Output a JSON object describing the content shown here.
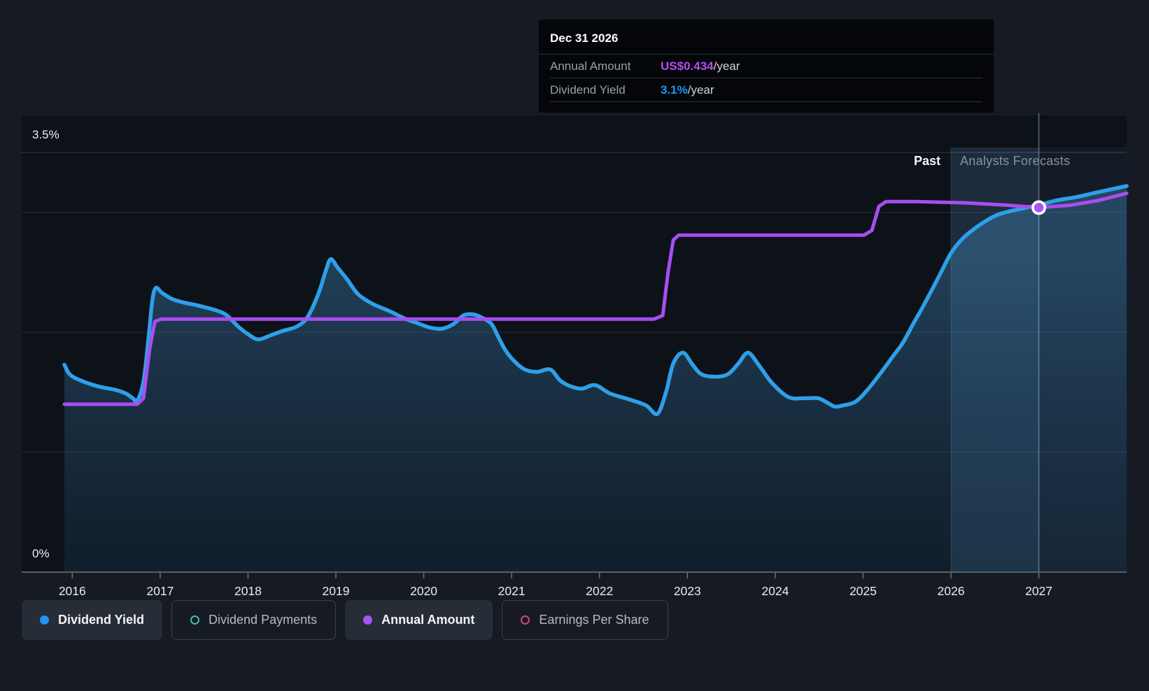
{
  "tooltip": {
    "title": "Dec 31 2026",
    "rows": [
      {
        "label": "Annual Amount",
        "value": "US$0.434",
        "suffix": "/year",
        "value_color": "#b44bf2"
      },
      {
        "label": "Dividend Yield",
        "value": "3.1%",
        "suffix": "/year",
        "value_color": "#2196f3"
      }
    ]
  },
  "axis": {
    "top_label": "3.5%",
    "bottom_label": "0%"
  },
  "regions": {
    "past_label": "Past",
    "forecast_label": "Analysts Forecasts"
  },
  "chart_data": {
    "type": "area",
    "title": "Dividend history and forecast",
    "x_ticks": [
      "2016",
      "2017",
      "2018",
      "2019",
      "2020",
      "2021",
      "2022",
      "2023",
      "2024",
      "2025",
      "2026",
      "2027"
    ],
    "x_tick_years": [
      2016,
      2017,
      2018,
      2019,
      2020,
      2021,
      2022,
      2023,
      2024,
      2025,
      2026,
      2027
    ],
    "x_range": [
      2015.91,
      2028.0
    ],
    "y_axis": {
      "min_pct": 0,
      "max_pct": 3.5,
      "gridlines_pct": [
        3.5,
        3.0,
        2.0,
        1.0
      ]
    },
    "forecast_divider_year": 2026.0,
    "hover_band_years": [
      2026.0,
      2027.0
    ],
    "selected_point": {
      "date": "Dec 31 2026",
      "year": 2027.0,
      "annual_amount_displayed": "US$0.434/year",
      "dividend_yield_displayed": "3.1%/year",
      "plotted_pct": 3.04
    },
    "series": [
      {
        "name": "Dividend Yield",
        "color": "#2e9fe8",
        "area": true,
        "smooth": true,
        "points": [
          [
            2015.91,
            1.73
          ],
          [
            2015.97,
            1.65
          ],
          [
            2016.09,
            1.6
          ],
          [
            2016.29,
            1.55
          ],
          [
            2016.49,
            1.52
          ],
          [
            2016.61,
            1.49
          ],
          [
            2016.69,
            1.45
          ],
          [
            2016.74,
            1.43
          ],
          [
            2016.81,
            1.59
          ],
          [
            2016.87,
            1.97
          ],
          [
            2016.91,
            2.26
          ],
          [
            2016.95,
            2.37
          ],
          [
            2017.02,
            2.33
          ],
          [
            2017.13,
            2.28
          ],
          [
            2017.26,
            2.25
          ],
          [
            2017.45,
            2.22
          ],
          [
            2017.65,
            2.18
          ],
          [
            2017.76,
            2.14
          ],
          [
            2017.9,
            2.04
          ],
          [
            2018.03,
            1.97
          ],
          [
            2018.12,
            1.94
          ],
          [
            2018.24,
            1.97
          ],
          [
            2018.39,
            2.01
          ],
          [
            2018.56,
            2.05
          ],
          [
            2018.68,
            2.13
          ],
          [
            2018.8,
            2.32
          ],
          [
            2018.88,
            2.5
          ],
          [
            2018.94,
            2.61
          ],
          [
            2019.02,
            2.54
          ],
          [
            2019.13,
            2.44
          ],
          [
            2019.25,
            2.32
          ],
          [
            2019.41,
            2.24
          ],
          [
            2019.6,
            2.18
          ],
          [
            2019.8,
            2.11
          ],
          [
            2019.95,
            2.07
          ],
          [
            2020.07,
            2.04
          ],
          [
            2020.21,
            2.03
          ],
          [
            2020.34,
            2.07
          ],
          [
            2020.45,
            2.14
          ],
          [
            2020.56,
            2.15
          ],
          [
            2020.67,
            2.12
          ],
          [
            2020.77,
            2.07
          ],
          [
            2020.85,
            1.96
          ],
          [
            2020.93,
            1.85
          ],
          [
            2021.03,
            1.76
          ],
          [
            2021.15,
            1.69
          ],
          [
            2021.29,
            1.67
          ],
          [
            2021.44,
            1.69
          ],
          [
            2021.55,
            1.6
          ],
          [
            2021.67,
            1.55
          ],
          [
            2021.8,
            1.53
          ],
          [
            2021.95,
            1.56
          ],
          [
            2022.12,
            1.49
          ],
          [
            2022.34,
            1.44
          ],
          [
            2022.53,
            1.39
          ],
          [
            2022.66,
            1.32
          ],
          [
            2022.76,
            1.51
          ],
          [
            2022.84,
            1.74
          ],
          [
            2022.95,
            1.83
          ],
          [
            2023.06,
            1.73
          ],
          [
            2023.16,
            1.65
          ],
          [
            2023.31,
            1.63
          ],
          [
            2023.46,
            1.65
          ],
          [
            2023.58,
            1.74
          ],
          [
            2023.69,
            1.83
          ],
          [
            2023.81,
            1.73
          ],
          [
            2023.96,
            1.58
          ],
          [
            2024.15,
            1.46
          ],
          [
            2024.33,
            1.45
          ],
          [
            2024.49,
            1.45
          ],
          [
            2024.6,
            1.41
          ],
          [
            2024.68,
            1.38
          ],
          [
            2024.77,
            1.39
          ],
          [
            2024.91,
            1.42
          ],
          [
            2025.05,
            1.52
          ],
          [
            2025.21,
            1.67
          ],
          [
            2025.34,
            1.8
          ],
          [
            2025.45,
            1.91
          ],
          [
            2025.57,
            2.07
          ],
          [
            2025.67,
            2.2
          ],
          [
            2025.78,
            2.35
          ],
          [
            2025.88,
            2.49
          ],
          [
            2026.0,
            2.66
          ],
          [
            2026.13,
            2.78
          ],
          [
            2026.26,
            2.86
          ],
          [
            2026.4,
            2.93
          ],
          [
            2026.53,
            2.98
          ],
          [
            2026.67,
            3.01
          ],
          [
            2026.8,
            3.03
          ],
          [
            2026.92,
            3.05
          ],
          [
            2027.0,
            3.06
          ],
          [
            2027.2,
            3.1
          ],
          [
            2027.44,
            3.13
          ],
          [
            2027.68,
            3.17
          ],
          [
            2028.0,
            3.22
          ]
        ]
      },
      {
        "name": "Annual Amount",
        "color": "#a84df0",
        "area": false,
        "smooth": false,
        "note": "plotted against a hidden amount axis; values expressed as left-axis equivalents; labeled value US$0.434/year at Dec 31 2026",
        "points": [
          [
            2015.91,
            1.4
          ],
          [
            2016.74,
            1.4
          ],
          [
            2016.81,
            1.45
          ],
          [
            2016.88,
            1.86
          ],
          [
            2016.94,
            2.09
          ],
          [
            2017.01,
            2.11
          ],
          [
            2022.62,
            2.11
          ],
          [
            2022.72,
            2.14
          ],
          [
            2022.78,
            2.5
          ],
          [
            2022.84,
            2.77
          ],
          [
            2022.9,
            2.81
          ],
          [
            2025.01,
            2.81
          ],
          [
            2025.1,
            2.85
          ],
          [
            2025.18,
            3.05
          ],
          [
            2025.26,
            3.09
          ],
          [
            2025.61,
            3.09
          ],
          [
            2026.16,
            3.08
          ],
          [
            2026.64,
            3.06
          ],
          [
            2027.0,
            3.04
          ],
          [
            2027.36,
            3.06
          ],
          [
            2027.68,
            3.1
          ],
          [
            2028.0,
            3.16
          ]
        ]
      }
    ],
    "legend_position": "bottom"
  },
  "legend": {
    "items": [
      {
        "label": "Dividend Yield",
        "marker": "filled",
        "color": "#2196f3",
        "active": true
      },
      {
        "label": "Dividend Payments",
        "marker": "ring",
        "color": "#41c0b3",
        "active": false
      },
      {
        "label": "Annual Amount",
        "marker": "filled",
        "color": "#a855f7",
        "active": true
      },
      {
        "label": "Earnings Per Share",
        "marker": "ring",
        "color": "#d0487f",
        "active": false
      }
    ]
  }
}
